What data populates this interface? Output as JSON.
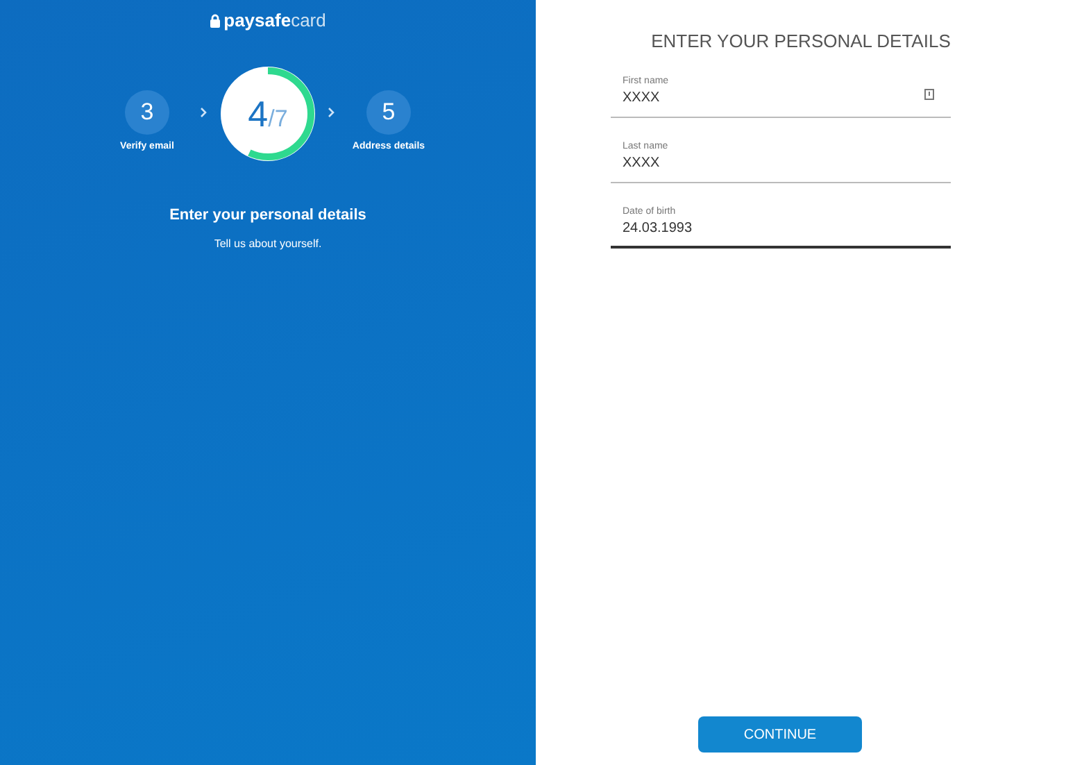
{
  "logo": {
    "bold": "paysafe",
    "light": "card"
  },
  "steps": {
    "previous": {
      "number": "3",
      "label": "Verify email"
    },
    "current": {
      "number": "4",
      "total": "/7",
      "level": 0.57
    },
    "next": {
      "number": "5",
      "label": "Address details"
    }
  },
  "intro": {
    "heading": "Enter your personal details",
    "subheading": "Tell us about yourself."
  },
  "form": {
    "title": "ENTER YOUR PERSONAL DETAILS",
    "fields": [
      {
        "label": "First name",
        "value": "XXXX",
        "focused": false,
        "autofill_icon": true
      },
      {
        "label": "Last name",
        "value": "XXXX",
        "focused": false,
        "autofill_icon": false
      },
      {
        "label": "Date of birth",
        "value": "24.03.1993",
        "focused": true,
        "autofill_icon": false
      }
    ],
    "button": "CONTINUE"
  }
}
